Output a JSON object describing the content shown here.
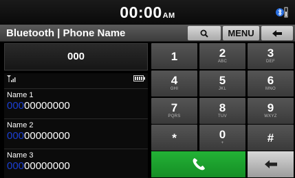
{
  "status_bar": {
    "time": "00:00",
    "ampm": "AM",
    "bluetooth_icon": "bluetooth-battery-icon"
  },
  "title_bar": {
    "title": "Bluetooth | Phone Name",
    "menu_label": "MENU",
    "search_icon": "search-icon",
    "back_icon": "back-arrow-icon"
  },
  "dial": {
    "number": "000"
  },
  "indicators": {
    "signal_icon": "signal-icon",
    "battery_icon": "battery-icon"
  },
  "contacts": [
    {
      "name": "Name 1",
      "number_highlight": "000",
      "number_rest": "00000000"
    },
    {
      "name": "Name 2",
      "number_highlight": "000",
      "number_rest": "00000000"
    },
    {
      "name": "Name 3",
      "number_highlight": "000",
      "number_rest": "00000000"
    }
  ],
  "keypad": [
    {
      "key": "1",
      "sub": ""
    },
    {
      "key": "2",
      "sub": "ABC"
    },
    {
      "key": "3",
      "sub": "DEF"
    },
    {
      "key": "4",
      "sub": "GHI"
    },
    {
      "key": "5",
      "sub": "JKL"
    },
    {
      "key": "6",
      "sub": "MNO"
    },
    {
      "key": "7",
      "sub": "PQRS"
    },
    {
      "key": "8",
      "sub": "TUV"
    },
    {
      "key": "9",
      "sub": "WXYZ"
    },
    {
      "key": "*",
      "sub": ""
    },
    {
      "key": "0",
      "sub": "+"
    },
    {
      "key": "#",
      "sub": ""
    }
  ],
  "colors": {
    "call_green": "#1ea42f",
    "highlight_blue": "#1b3fd4"
  },
  "actions": {
    "call_icon": "phone-icon",
    "delete_icon": "backspace-arrow-icon"
  }
}
